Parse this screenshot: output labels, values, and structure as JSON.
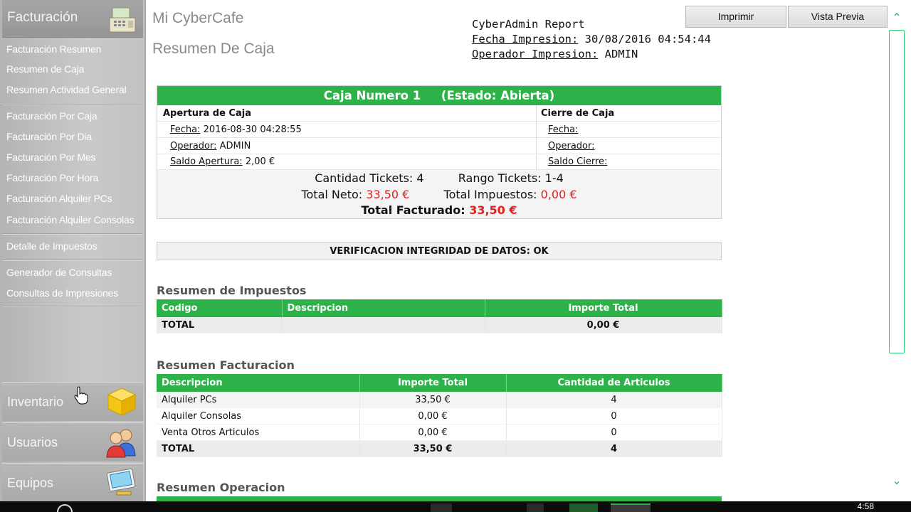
{
  "sidebar": {
    "header_label": "Facturación",
    "items": [
      {
        "label": "Facturación Resumen"
      },
      {
        "label": "Resumen de Caja"
      },
      {
        "label": "Resumen Actividad General"
      },
      {
        "label": "Facturación Por Caja"
      },
      {
        "label": "Facturación Por Dia"
      },
      {
        "label": "Facturación Por Mes"
      },
      {
        "label": "Facturación Por Hora"
      },
      {
        "label": "Facturación Alquiler PCs"
      },
      {
        "label": "Facturación Alquiler Consolas"
      },
      {
        "label": "Detalle de Impuestos"
      },
      {
        "label": "Generador de Consultas"
      },
      {
        "label": "Consultas de Impresiones"
      }
    ],
    "sections": [
      {
        "label": "Inventario",
        "icon": "box-icon"
      },
      {
        "label": "Usuarios",
        "icon": "users-icon"
      },
      {
        "label": "Equipos",
        "icon": "monitor-icon"
      }
    ]
  },
  "header": {
    "app_title": "Mi CyberCafe",
    "page_title": "Resumen De Caja",
    "report_title": "CyberAdmin Report",
    "fecha_label": "Fecha Impresion:",
    "fecha_value": "30/08/2016 04:54:44",
    "operador_label": "Operador Impresion:",
    "operador_value": "ADMIN",
    "print_button": "Imprimir",
    "preview_button": "Vista Previa"
  },
  "caja": {
    "title": "Caja Numero 1     (Estado: Abierta)",
    "apertura_title": "Apertura de Caja",
    "cierre_title": "Cierre de Caja",
    "apertura_fecha_label": "Fecha:",
    "apertura_fecha_value": "2016-08-30 04:28:55",
    "apertura_operador_label": "Operador:",
    "apertura_operador_value": "ADMIN",
    "apertura_saldo_label": "Saldo Apertura:",
    "apertura_saldo_value": "2,00 €",
    "cierre_fecha_label": "Fecha:",
    "cierre_operador_label": "Operador:",
    "cierre_saldo_label": "Saldo Cierre:",
    "cantidad_tickets_label": "Cantidad Tickets:",
    "cantidad_tickets_value": "4",
    "rango_tickets_label": "Rango Tickets:",
    "rango_tickets_value": "1-4",
    "total_neto_label": "Total Neto:",
    "total_neto_value": "33,50 €",
    "total_impuestos_label": "Total Impuestos:",
    "total_impuestos_value": "0,00 €",
    "total_facturado_label": "Total Facturado:",
    "total_facturado_value": "33,50 €"
  },
  "verificacion": "VERIFICACION INTEGRIDAD DE DATOS: OK",
  "impuestos": {
    "title": "Resumen de Impuestos",
    "headers": [
      "Codigo",
      "Descripcion",
      "Importe Total"
    ],
    "total_row": [
      "TOTAL",
      "",
      "0,00 €"
    ]
  },
  "facturacion": {
    "title": "Resumen Facturacion",
    "headers": [
      "Descripcion",
      "Importe Total",
      "Cantidad de Articulos"
    ],
    "rows": [
      [
        "Alquiler PCs",
        "33,50 €",
        "4"
      ],
      [
        "Alquiler Consolas",
        "0,00 €",
        "0"
      ],
      [
        "Venta Otros Articulos",
        "0,00 €",
        "0"
      ]
    ],
    "total_row": [
      "TOTAL",
      "33,50 €",
      "4"
    ]
  },
  "operacion": {
    "title": "Resumen Operacion"
  },
  "taskbar": {
    "clock": "4:58"
  },
  "colors": {
    "accent_green": "#2db24a",
    "value_red": "#e0201e",
    "sidebar_gray": "#c2c2c2"
  }
}
